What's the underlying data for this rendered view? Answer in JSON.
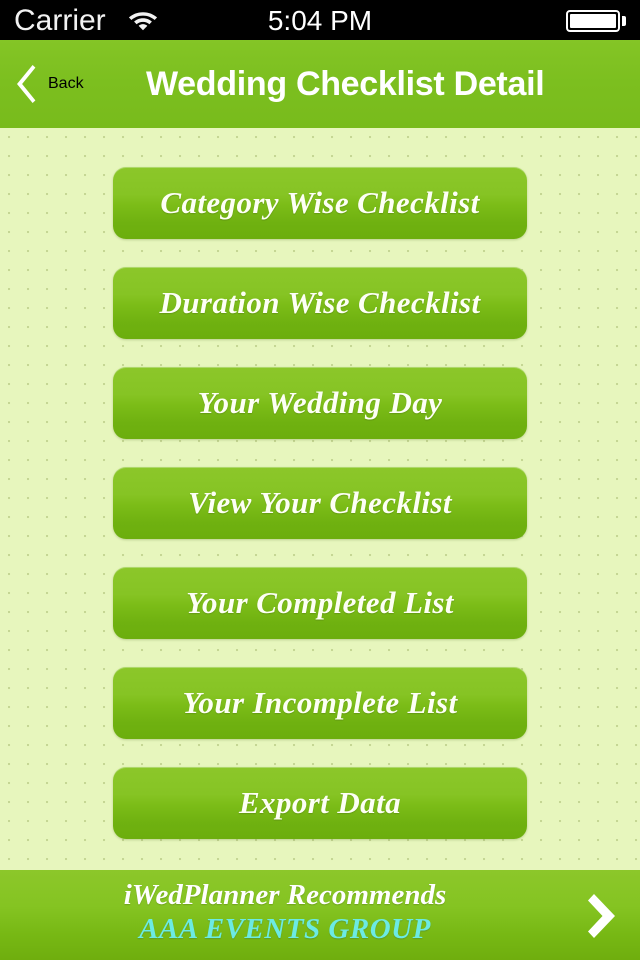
{
  "status_bar": {
    "carrier": "Carrier",
    "wifi_icon": "wifi-icon",
    "time": "5:04 PM",
    "battery_icon": "battery-full-icon"
  },
  "navbar": {
    "back_icon": "chevron-left-icon",
    "back_label": "Back",
    "title": "Wedding Checklist Detail",
    "background_color": "#7cbf1f"
  },
  "menu": {
    "buttons": [
      {
        "label": "Category Wise Checklist",
        "name": "category-wise-checklist-button"
      },
      {
        "label": "Duration Wise Checklist",
        "name": "duration-wise-checklist-button"
      },
      {
        "label": "Your Wedding Day",
        "name": "your-wedding-day-button"
      },
      {
        "label": "View Your Checklist",
        "name": "view-your-checklist-button"
      },
      {
        "label": "Your Completed List",
        "name": "your-completed-list-button"
      },
      {
        "label": "Your Incomplete List",
        "name": "your-incomplete-list-button"
      },
      {
        "label": "Export Data",
        "name": "export-data-button"
      }
    ],
    "button_color_top": "#8cc72a",
    "button_color_bottom": "#6cae0d",
    "background_color": "#e7f6bd"
  },
  "banner": {
    "line1": "iWedPlanner Recommends",
    "line2": "AAA EVENTS GROUP",
    "line2_color": "#6ceae3",
    "arrow_icon": "chevron-right-icon"
  }
}
